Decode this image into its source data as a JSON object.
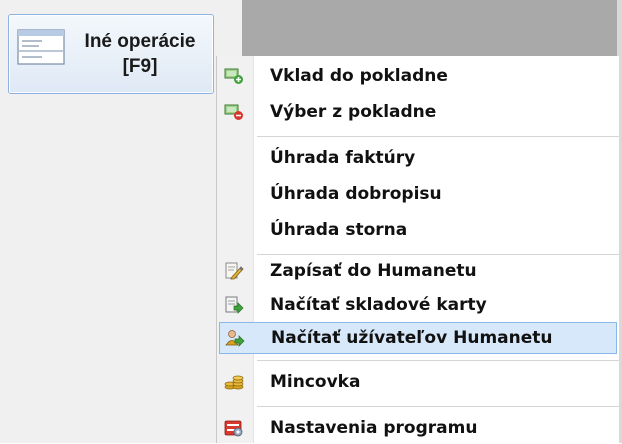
{
  "toolbar": {
    "button_label_line1": "Iné operácie",
    "button_label_line2": "[F9]",
    "button_icon": "document-list-icon"
  },
  "menu": {
    "items": [
      {
        "label": "Vklad do pokladne",
        "icon": "cash-deposit-icon",
        "highlighted": false
      },
      {
        "label": "Výber z pokladne",
        "icon": "cash-withdraw-icon",
        "highlighted": false
      },
      {
        "label": "Úhrada faktúry",
        "icon": "",
        "highlighted": false
      },
      {
        "label": "Úhrada dobropisu",
        "icon": "",
        "highlighted": false
      },
      {
        "label": "Úhrada storna",
        "icon": "",
        "highlighted": false
      },
      {
        "label": "Zapísať do Humanetu",
        "icon": "write-note-icon",
        "highlighted": false
      },
      {
        "label": "Načítať skladové karty",
        "icon": "load-document-icon",
        "highlighted": false
      },
      {
        "label": "Načítať užívateľov Humanetu",
        "icon": "load-users-icon",
        "highlighted": true
      },
      {
        "label": "Mincovka",
        "icon": "coins-icon",
        "highlighted": false
      },
      {
        "label": "Nastavenia programu",
        "icon": "settings-icon",
        "highlighted": false
      }
    ]
  },
  "colors": {
    "highlight_bg": "#d7e8fa",
    "highlight_border": "#8bb8ea",
    "button_border": "#8db2e3",
    "top_strip": "#a9a9a9"
  }
}
